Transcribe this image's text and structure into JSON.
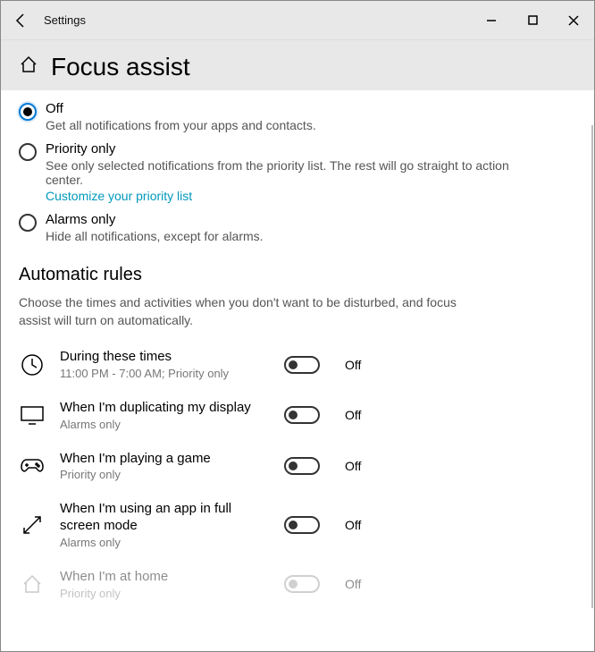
{
  "window": {
    "title": "Settings",
    "page_heading": "Focus assist"
  },
  "mode": {
    "options": [
      {
        "label": "Off",
        "desc": "Get all notifications from your apps and contacts.",
        "selected": true
      },
      {
        "label": "Priority only",
        "desc": "See only selected notifications from the priority list. The rest will go straight to action center.",
        "link": "Customize your priority list",
        "selected": false
      },
      {
        "label": "Alarms only",
        "desc": "Hide all notifications, except for alarms.",
        "selected": false
      }
    ]
  },
  "rules": {
    "heading": "Automatic rules",
    "desc": "Choose the times and activities when you don't want to be disturbed, and focus assist will turn on automatically.",
    "items": [
      {
        "label": "During these times",
        "sub": "11:00 PM - 7:00 AM; Priority only",
        "state": "Off",
        "icon": "clock"
      },
      {
        "label": "When I'm duplicating my display",
        "sub": "Alarms only",
        "state": "Off",
        "icon": "monitor"
      },
      {
        "label": "When I'm playing a game",
        "sub": "Priority only",
        "state": "Off",
        "icon": "gamepad"
      },
      {
        "label": "When I'm using an app in full screen mode",
        "sub": "Alarms only",
        "state": "Off",
        "icon": "fullscreen"
      },
      {
        "label": "When I'm at home",
        "sub": "Priority only",
        "state": "Off",
        "icon": "home",
        "disabled": true
      }
    ]
  }
}
